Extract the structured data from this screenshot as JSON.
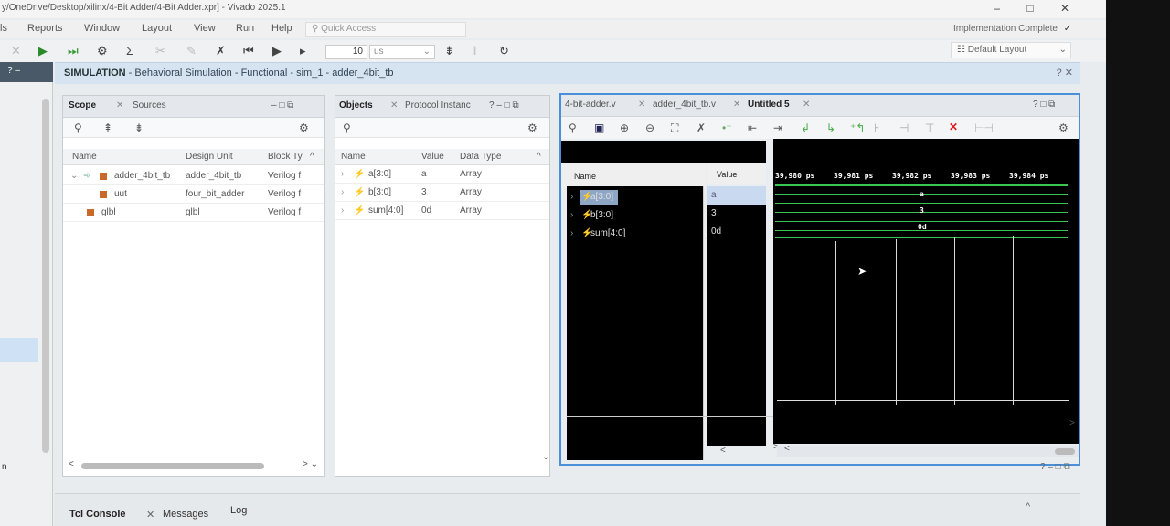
{
  "window": {
    "title": "y/OneDrive/Desktop/xilinx/4-Bit Adder/4-Bit Adder.xpr] - Vivado 2025.1",
    "minimize": "–",
    "maximize": "□",
    "close": "✕"
  },
  "menubar": {
    "items": [
      "ls",
      "Reports",
      "Window",
      "Layout",
      "View",
      "Run",
      "Help"
    ],
    "quick_access_placeholder": "Quick Access",
    "status": "Implementation Complete",
    "status_check": "✓"
  },
  "toolbar": {
    "run_time": "10",
    "run_unit": "us",
    "layout": "Default Layout"
  },
  "left_strip": {
    "header": "? –",
    "bottom_char": "n"
  },
  "simulation_header": {
    "label": "SIMULATION",
    "detail": " - Behavioral Simulation - Functional - sim_1 - adder_4bit_tb",
    "help": "? ✕"
  },
  "scope_panel": {
    "tabs": [
      "Scope",
      "Sources"
    ],
    "columns": [
      "Name",
      "Design Unit",
      "Block Ty"
    ],
    "rows": [
      {
        "name": "adder_4bit_tb",
        "unit": "adder_4bit_tb",
        "type": "Verilog f"
      },
      {
        "name": "uut",
        "unit": "four_bit_adder",
        "type": "Verilog f"
      },
      {
        "name": "glbl",
        "unit": "glbl",
        "type": "Verilog f"
      }
    ],
    "window_controls": "–  □  ⧉"
  },
  "objects_panel": {
    "tabs": [
      "Objects",
      "Protocol Instanc"
    ],
    "columns": [
      "Name",
      "Value",
      "Data Type"
    ],
    "rows": [
      {
        "name": "a[3:0]",
        "value": "a",
        "type": "Array"
      },
      {
        "name": "b[3:0]",
        "value": "3",
        "type": "Array"
      },
      {
        "name": "sum[4:0]",
        "value": "0d",
        "type": "Array"
      }
    ],
    "window_controls": "?  –  □  ⧉"
  },
  "wave_panel": {
    "tabs": [
      "4-bit-adder.v",
      "adder_4bit_tb.v",
      "Untitled 5"
    ],
    "name_header": "Name",
    "value_header": "Value",
    "signals": [
      {
        "name": "a[3:0]",
        "value": "a"
      },
      {
        "name": "b[3:0]",
        "value": "3"
      },
      {
        "name": "sum[4:0]",
        "value": "0d"
      }
    ],
    "timestamps": [
      "39,980 ps",
      "39,981 ps",
      "39,982 ps",
      "39,983 ps",
      "39,984 ps"
    ],
    "trace_labels": [
      "a",
      "3",
      "0d"
    ],
    "window_controls": "?  □  ⧉"
  },
  "bottom_panel": {
    "tabs": [
      "Tcl Console",
      "Messages",
      "Log"
    ],
    "window_controls": "?  –  □  ⧉",
    "collapse": "^"
  }
}
